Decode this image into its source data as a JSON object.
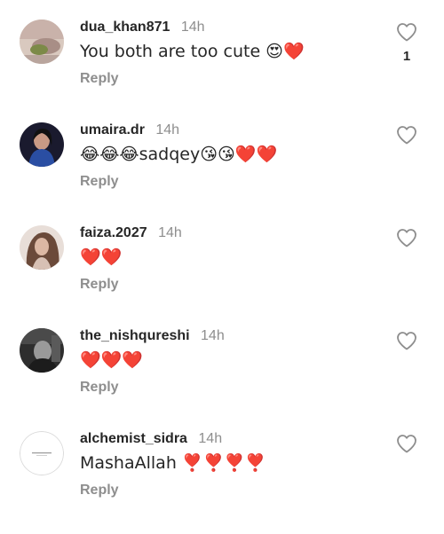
{
  "comments": [
    {
      "username": "dua_khan871",
      "time": "14h",
      "text": "You both are too cute 😍❤️",
      "reply_label": "Reply",
      "likes": "1",
      "avatar_icon": "profile-photo"
    },
    {
      "username": "umaira.dr",
      "time": "14h",
      "text": "😂😂😂sadqey😘😘❤️❤️",
      "reply_label": "Reply",
      "avatar_icon": "profile-photo"
    },
    {
      "username": "faiza.2027",
      "time": "14h",
      "text": "❤️❤️",
      "reply_label": "Reply",
      "avatar_icon": "profile-photo"
    },
    {
      "username": "the_nishqureshi",
      "time": "14h",
      "text": "❤️❤️❤️",
      "reply_label": "Reply",
      "avatar_icon": "profile-photo"
    },
    {
      "username": "alchemist_sidra",
      "time": "14h",
      "text": "MashaAllah ❣️❣️❣️❣️",
      "reply_label": "Reply",
      "avatar_icon": "logo-avatar"
    }
  ],
  "colors": {
    "heart": "#ed2a3e",
    "muted": "#8e8e8e",
    "text": "#262626"
  }
}
